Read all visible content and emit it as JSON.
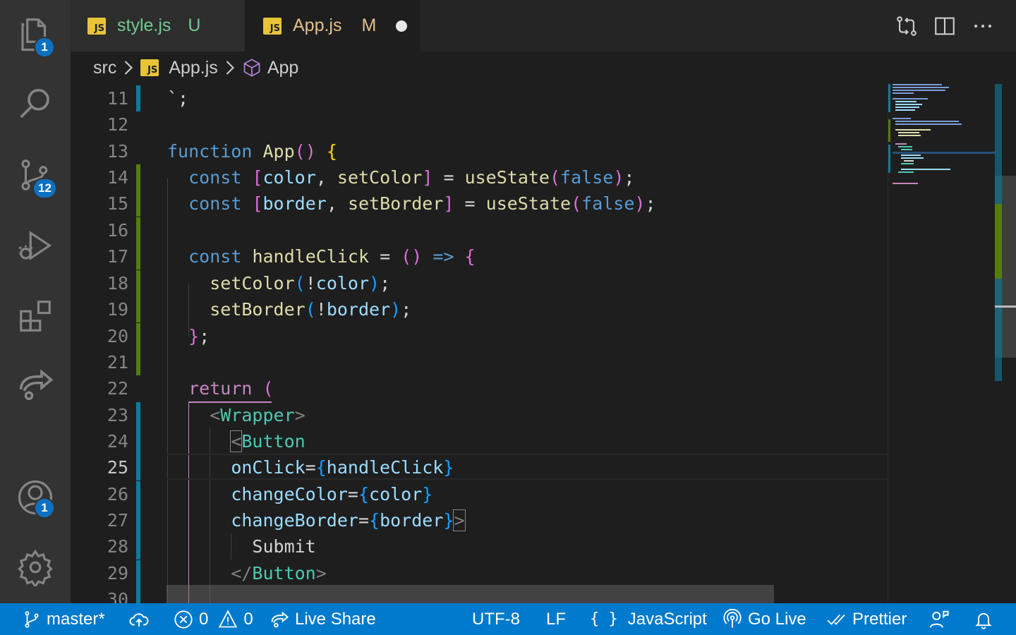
{
  "tabs": [
    {
      "name": "style.js",
      "status": "U",
      "icon": "js-file-icon"
    },
    {
      "name": "App.js",
      "status": "M",
      "icon": "js-file-icon",
      "dirty": true
    }
  ],
  "breadcrumb": {
    "folder": "src",
    "file": "App.js",
    "symbol": "App"
  },
  "activity_badges": {
    "explorer": "1",
    "source_control": "12",
    "accounts": "1"
  },
  "line_numbers": [
    "11",
    "12",
    "13",
    "14",
    "15",
    "16",
    "17",
    "18",
    "19",
    "20",
    "21",
    "22",
    "23",
    "24",
    "25",
    "26",
    "27",
    "28",
    "29",
    "30"
  ],
  "current_line": "25",
  "status": {
    "branch": "master*",
    "errors": "0",
    "warnings": "0",
    "live_share": "Live Share",
    "encoding": "UTF-8",
    "eol": "LF",
    "language_icon": "{ }",
    "language": "JavaScript",
    "go_live": "Go Live",
    "prettier": "Prettier"
  },
  "colors": {
    "accent": "#007acc",
    "activity_bar": "#333333",
    "editor_bg": "#1e1e1e"
  }
}
